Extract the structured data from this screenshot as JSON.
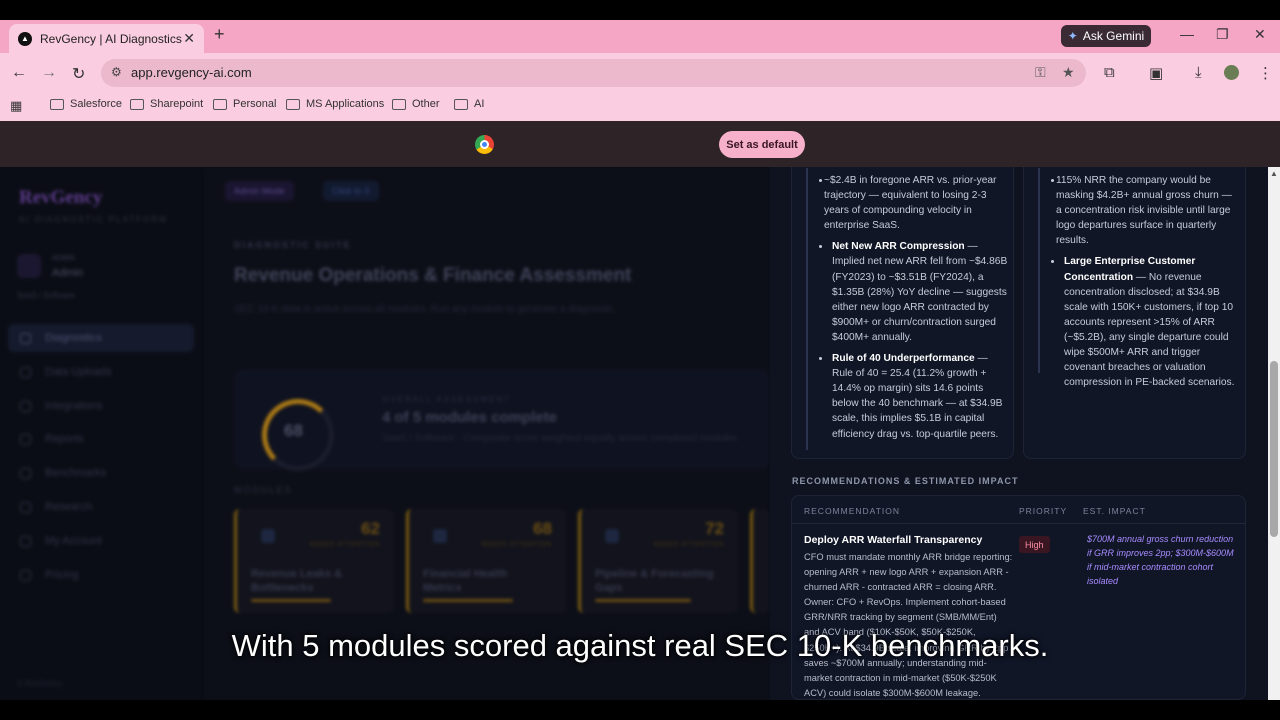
{
  "browser": {
    "tab_title": "RevGency | AI Diagnostics",
    "gemini_label": "Ask Gemini",
    "url": "app.revgency-ai.com",
    "bookmarks": [
      "Salesforce",
      "Sharepoint",
      "Personal",
      "MS Applications",
      "Other",
      "AI"
    ],
    "infobar_button": "Set as default"
  },
  "sidebar": {
    "logo": "RevGency",
    "logo_sub": "AI DIAGNOSTIC PLATFORM",
    "role_small": "ADMIN",
    "role_name": "Admin",
    "industry": "SaaS / Software",
    "items": [
      {
        "label": "Diagnostics"
      },
      {
        "label": "Data Uploads"
      },
      {
        "label": "Integrations"
      },
      {
        "label": "Reports"
      },
      {
        "label": "Benchmarks"
      },
      {
        "label": "Research"
      },
      {
        "label": "My Account"
      },
      {
        "label": "Pricing"
      }
    ],
    "footer": "© RevGency"
  },
  "main": {
    "chip_admin": "Admin Mode",
    "chip_link": "Click to X",
    "suite_label": "DIAGNOSTIC SUITE",
    "title": "Revenue Operations & Finance Assessment",
    "subtitle": "SEC 10-K data is active across all modules. Run any module to generate a diagnostic.",
    "overall": {
      "score": "68",
      "label": "OVERALL ASSESSMENT",
      "title": "4 of 5 modules complete",
      "sub": "SaaS / Software · Composite score weighted equally across completed modules"
    },
    "modules_label": "MODULES",
    "modules": [
      {
        "score": "62",
        "badge": "NEEDS ATTENTION",
        "name": "Revenue Leaks & Bottlenecks"
      },
      {
        "score": "68",
        "badge": "NEEDS ATTENTION",
        "name": "Financial Health Metrics"
      },
      {
        "score": "72",
        "badge": "NEEDS ATTENTION",
        "name": "Pipeline & Forecasting Gaps"
      }
    ]
  },
  "panel": {
    "left_card": {
      "items": [
        {
          "lead": "",
          "text": "~$2.4B in foregone ARR vs. prior-year trajectory — equivalent to losing 2-3 years of compounding velocity in enterprise SaaS."
        },
        {
          "lead": "Net New ARR Compression",
          "text": " — Implied net new ARR fell from ~$4.86B (FY2023) to ~$3.51B (FY2024), a $1.35B (28%) YoY decline — suggests either new logo ARR contracted by $900M+ or churn/contraction surged $400M+ annually."
        },
        {
          "lead": "Rule of 40 Underperformance",
          "text": " — Rule of 40 = 25.4 (11.2% growth + 14.4% op margin) sits 14.6 points below the 40 benchmark — at $34.9B scale, this implies $5.1B in capital efficiency drag vs. top-quartile peers."
        }
      ]
    },
    "right_card": {
      "items": [
        {
          "lead": "",
          "text": "115% NRR the company would be masking $4.2B+ annual gross churn — a concentration risk invisible until large logo departures surface in quarterly results."
        },
        {
          "lead": "Large Enterprise Customer Concentration",
          "text": " — No revenue concentration disclosed; at $34.9B scale with 150K+ customers, if top 10 accounts represent >15% of ARR (~$5.2B), any single departure could wipe $500M+ ARR and trigger covenant breaches or valuation compression in PE-backed scenarios."
        }
      ]
    },
    "rec_section_title": "RECOMMENDATIONS & ESTIMATED IMPACT",
    "rec_headers": [
      "RECOMMENDATION",
      "PRIORITY",
      "EST. IMPACT"
    ],
    "recommendations": [
      {
        "title": "Deploy ARR Waterfall Transparency",
        "desc": "CFO must mandate monthly ARR bridge reporting: opening ARR + new logo ARR + expansion ARR - churned ARR - contracted ARR = closing ARR. Owner: CFO + RevOps. Implement cohort-based GRR/NRR tracking by segment (SMB/MM/Ent) and ACV band ($10K-$50K, $50K-$250K, $250K+). At $34.9B scale, improving GRR by 2pp saves ~$700M annually; understanding mid-market contraction in mid-market ($50K-$250K ACV) could isolate $300M-$600M leakage.",
        "priority": "High",
        "impact": "$700M annual gross churn reduction if GRR improves 2pp; $300M-$600M if mid-market contraction cohort isolated"
      }
    ]
  },
  "caption": "With 5 modules scored against real SEC 10-K benchmarks."
}
